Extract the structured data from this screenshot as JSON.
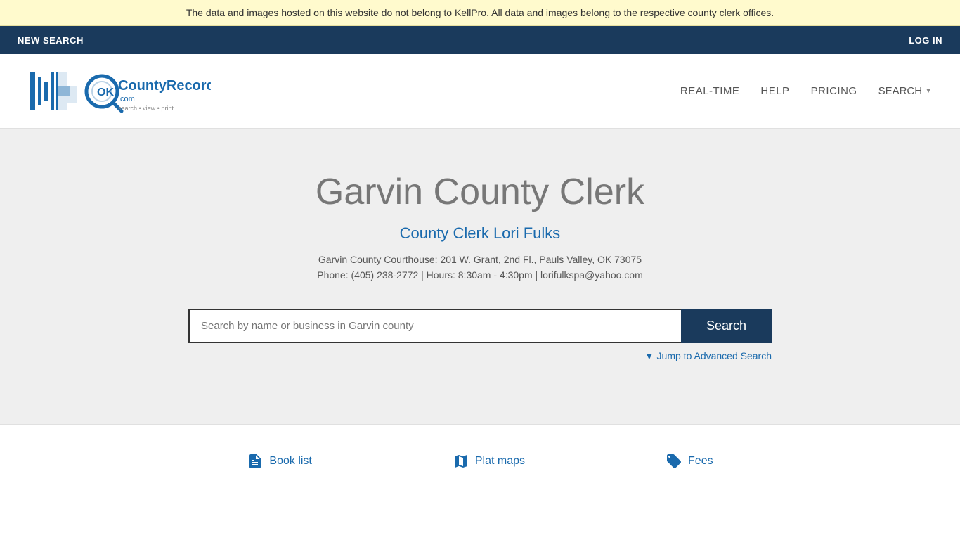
{
  "banner": {
    "text": "The data and images hosted on this website do not belong to KellPro. All data and images belong to the respective county clerk offices."
  },
  "nav": {
    "new_search_label": "NEW SEARCH",
    "log_in_label": "LOG IN"
  },
  "header": {
    "logo_text": "OKCountyRecords.com",
    "logo_tagline": "search • view • print",
    "nav_items": [
      {
        "label": "REAL-TIME",
        "id": "real-time"
      },
      {
        "label": "HELP",
        "id": "help"
      },
      {
        "label": "PRICING",
        "id": "pricing"
      },
      {
        "label": "SEARCH",
        "id": "search"
      }
    ]
  },
  "main": {
    "county_title": "Garvin County Clerk",
    "clerk_name": "County Clerk Lori Fulks",
    "address": "Garvin County Courthouse: 201 W. Grant, 2nd Fl., Pauls Valley, OK 73075",
    "contact": "Phone: (405) 238-2772 | Hours: 8:30am - 4:30pm | lorifulkspa@yahoo.com",
    "search_placeholder": "Search by name or business in Garvin county",
    "search_button_label": "Search",
    "advanced_search_label": "▼ Jump to Advanced Search"
  },
  "footer": {
    "links": [
      {
        "label": "Book list",
        "id": "book-list"
      },
      {
        "label": "Plat maps",
        "id": "plat-maps"
      },
      {
        "label": "Fees",
        "id": "fees"
      }
    ]
  }
}
